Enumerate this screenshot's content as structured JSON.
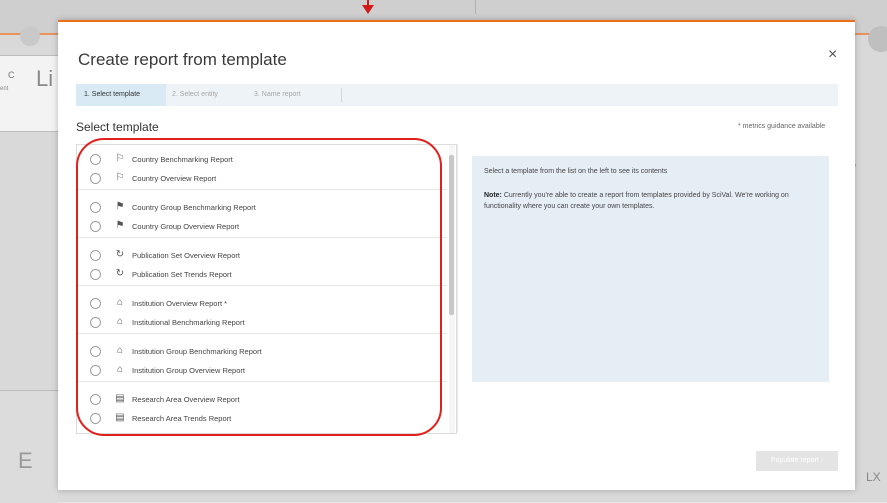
{
  "modal": {
    "title": "Create report from template",
    "close_label": "×",
    "steps": [
      {
        "label": "1. Select template",
        "active": true
      },
      {
        "label": "2. Select entity",
        "active": false
      },
      {
        "label": "3. Name report",
        "active": false
      }
    ],
    "section_title": "Select template",
    "guidance_note": "* metrics guidance available",
    "populate_button": "Populate report  ›"
  },
  "templates": {
    "country": [
      "Country Benchmarking Report",
      "Country Overview Report"
    ],
    "country_group": [
      "Country Group Benchmarking Report",
      "Country Group Overview Report"
    ],
    "publication": [
      "Publication Set Overview Report",
      "Publication Set Trends Report"
    ],
    "institution": [
      "Institution Overview Report *",
      "Institutional Benchmarking Report"
    ],
    "institution_group": [
      "Institution Group Benchmarking Report",
      "Institution Group Overview Report"
    ],
    "research_area": [
      "Research Area Overview Report",
      "Research Area Trends Report"
    ]
  },
  "preview": {
    "hint": "Select a template from the list on the left to see its contents",
    "note_label": "Note:",
    "note_text": " Currently you're able to create a report from templates provided by SciVal. We're working on functionality where you can create your own templates."
  },
  "background": {
    "panel_label": "C",
    "panel_sub": "ent",
    "heading_letter": "Li",
    "bottom_letter": "E",
    "right_label": "LX",
    "chevron": "›"
  },
  "icons": {
    "country": "flag-icon",
    "country_group": "flags-icon",
    "publication": "publication-set-icon",
    "institution": "institution-icon",
    "institution_group": "institution-group-icon",
    "research_area": "research-area-icon"
  },
  "colors": {
    "accent": "#e9711c",
    "highlight": "#e0201c",
    "step_active": "#d9eaf4",
    "preview_bg": "#e6eef5"
  }
}
